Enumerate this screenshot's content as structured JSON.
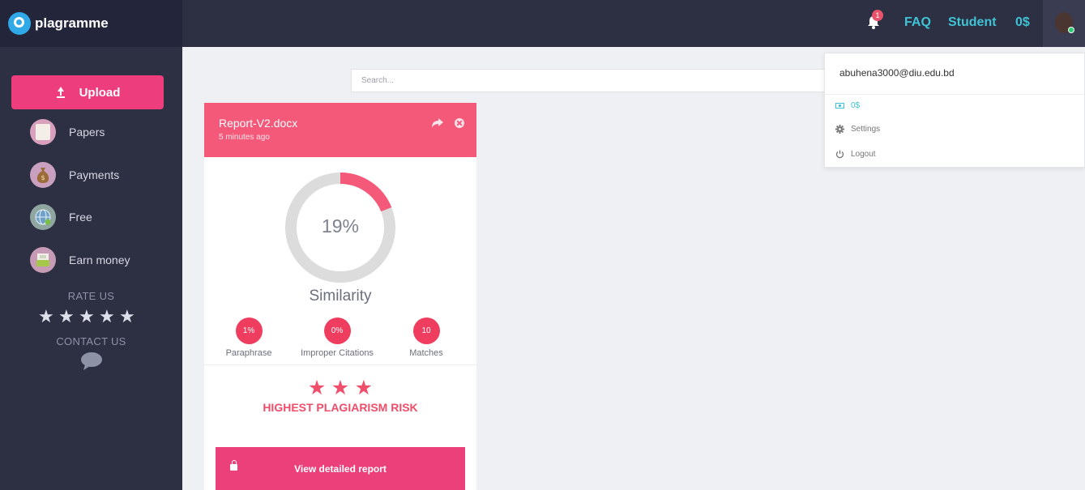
{
  "brand": {
    "name": "plagramme"
  },
  "sidebar": {
    "upload_label": "Upload",
    "items": [
      {
        "label": "Papers",
        "icon": "papers-icon"
      },
      {
        "label": "Payments",
        "icon": "money-bag-icon"
      },
      {
        "label": "Free",
        "icon": "globe-icon"
      },
      {
        "label": "Earn money",
        "icon": "cash-register-icon"
      }
    ],
    "rate_title": "RATE US",
    "rate_stars": [
      "★",
      "★",
      "★",
      "★",
      "★"
    ],
    "contact_title": "CONTACT US"
  },
  "header": {
    "notification_count": "1",
    "faq_label": "FAQ",
    "account_label": "Student",
    "balance_label": "0$"
  },
  "search": {
    "placeholder": "Search..."
  },
  "card": {
    "title": "Report-V2.docx",
    "time": "5 minutes ago",
    "similarity_percent": 19,
    "similarity_text": "19%",
    "similarity_label": "Similarity",
    "metrics": [
      {
        "value": "1%",
        "label": "Paraphrase"
      },
      {
        "value": "0%",
        "label": "Improper Citations"
      },
      {
        "value": "10",
        "label": "Matches"
      }
    ],
    "risk_stars": [
      "★",
      "★",
      "★"
    ],
    "risk_text": "HIGHEST PLAGIARISM RISK",
    "report_button": "View detailed report"
  },
  "dropdown": {
    "email": "abuhena3000@diu.edu.bd",
    "balance": "0$",
    "settings": "Settings",
    "logout": "Logout"
  },
  "colors": {
    "accent_pink": "#ee3d7c",
    "card_header": "#f5597a",
    "link_cyan": "#3fc4d6",
    "sidebar_bg": "#2d2f43"
  }
}
